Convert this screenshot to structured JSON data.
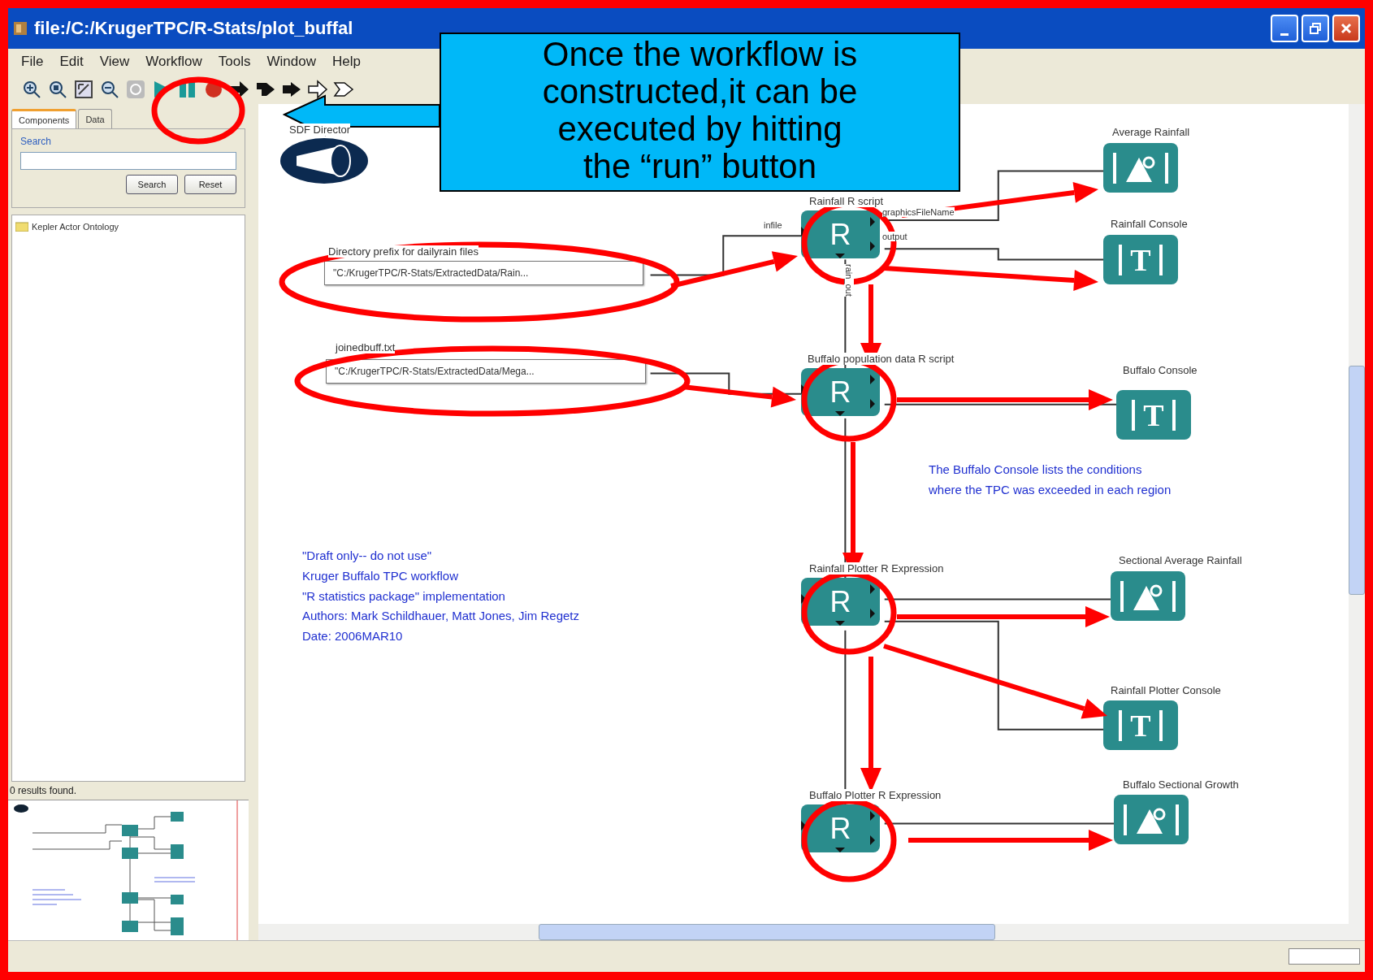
{
  "window": {
    "title": "file:/C:/KrugerTPC/R-Stats/plot_buffal"
  },
  "menu": [
    "File",
    "Edit",
    "View",
    "Workflow",
    "Tools",
    "Window",
    "Help"
  ],
  "sidebar": {
    "tabs": [
      {
        "label": "Components",
        "selected": true
      },
      {
        "label": "Data",
        "selected": false
      }
    ],
    "search_label": "Search",
    "buttons": [
      "Search",
      "Reset"
    ],
    "tree": [
      {
        "label": "Kepler Actor Ontology"
      }
    ],
    "results": "0 results found."
  },
  "canvas": {
    "director": {
      "label": "SDF Director"
    },
    "parameters": [
      {
        "label": "Directory prefix for dailyrain files",
        "value": "\"C:/KrugerTPC/R-Stats/ExtractedData/Rain..."
      },
      {
        "label": "joinedbuff.txt",
        "value": "\"C:/KrugerTPC/R-Stats/ExtractedData/Mega..."
      }
    ],
    "actors": [
      {
        "label": "Rainfall R script",
        "symbol": "R",
        "ports": [
          {
            "kind": "input",
            "label": "infile"
          },
          {
            "kind": "output",
            "label": "graphicsFileName"
          },
          {
            "kind": "output",
            "label": "output"
          },
          {
            "kind": "down",
            "label": "rain_out"
          }
        ]
      },
      {
        "label": "Buffalo population data R script",
        "symbol": "R"
      },
      {
        "label": "Rainfall Plotter R Expression",
        "symbol": "R"
      },
      {
        "label": "Buffalo Plotter R Expression",
        "symbol": "R"
      }
    ],
    "displays": [
      {
        "kind": "image",
        "label": "Average Rainfall"
      },
      {
        "kind": "text",
        "label": "Rainfall Console",
        "symbol": "T"
      },
      {
        "kind": "text",
        "label": "Buffalo Console",
        "symbol": "T"
      },
      {
        "kind": "image",
        "label": "Sectional Average Rainfall"
      },
      {
        "kind": "text",
        "label": "Rainfall Plotter Console",
        "symbol": "T"
      },
      {
        "kind": "image",
        "label": "Buffalo Sectional Growth"
      }
    ],
    "notes": [
      {
        "text": "The Buffalo Console lists the conditions\nwhere the TPC was exceeded in each region"
      },
      {
        "text": "\"Draft only-- do not use\"\nKruger Buffalo TPC workflow\n\"R statistics package\" implementation\nAuthors: Mark Schildhauer, Matt Jones, Jim Regetz\nDate: 2006MAR10"
      }
    ]
  },
  "callout": {
    "text": "Once the workflow is\nconstructed,it can be\nexecuted by hitting\nthe “run” button"
  }
}
